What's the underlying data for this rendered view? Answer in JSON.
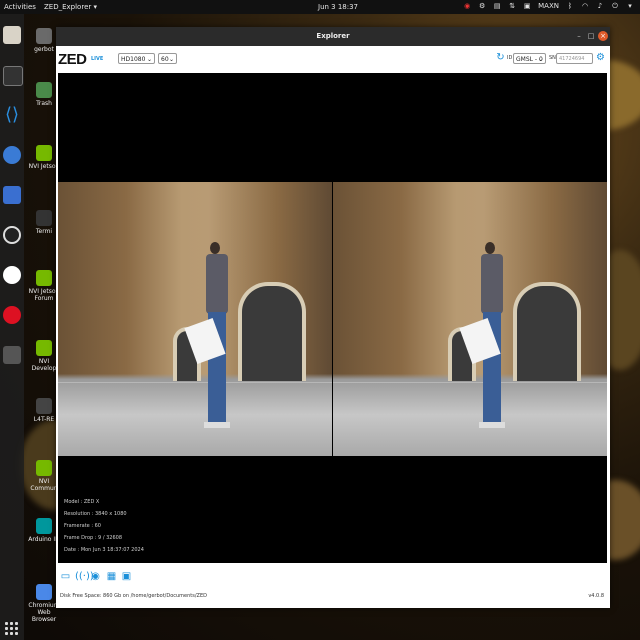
{
  "topbar": {
    "activities": "Activities",
    "app_menu": "ZED_Explorer ▾",
    "clock": "Jun 3  18:37",
    "user": "MAXN"
  },
  "desktop_icons": [
    {
      "label": "gerbot",
      "color": "#6a6a6a"
    },
    {
      "label": "Trash",
      "color": "#4a8a4a"
    },
    {
      "label": "NVI Jetson",
      "color": "#76b900"
    },
    {
      "label": "Termi",
      "color": "#333333"
    },
    {
      "label": "NVI Jetson Forum",
      "color": "#76b900"
    },
    {
      "label": "NVI Develop",
      "color": "#76b900"
    },
    {
      "label": "L4T-RE",
      "color": "#444444"
    },
    {
      "label": "NVI Commun",
      "color": "#76b900"
    },
    {
      "label": "Arduino ID",
      "color": "#00979c"
    },
    {
      "label": "Chromium Web Browser",
      "color": "#4a88e8"
    }
  ],
  "window": {
    "title": "Explorer",
    "logo": "ZED",
    "live_label": "LIVE",
    "resolution": "HD1080",
    "fps": "60",
    "id_label": "ID",
    "camera_id": "GMSL - 0",
    "sn_label": "SN",
    "sn_placeholder": "41724694"
  },
  "info": {
    "model": "Model : ZED X",
    "resolution": "Resolution : 3840 x 1080",
    "framerate": "Framerate : 60",
    "frame_drop": "Frame Drop : 9 / 32608",
    "date": "Date : Mon Jun 3 18:37:07 2024"
  },
  "footer": {
    "disk": "Disk Free Space: 860 Gb  on /home/gerbot/Documents/ZED",
    "version": "v4.0.8"
  },
  "colors": {
    "accent": "#1a8fd9",
    "close": "#e05a2b"
  }
}
